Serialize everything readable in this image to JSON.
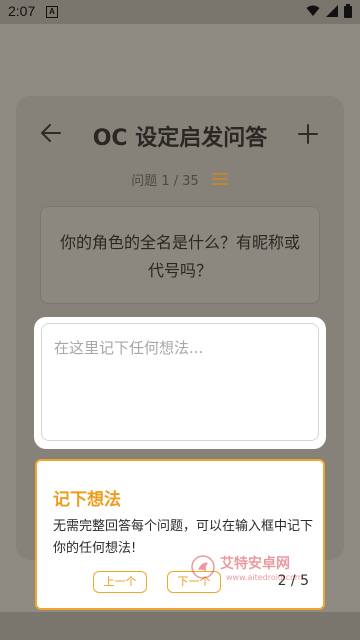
{
  "status_bar": {
    "time": "2:07",
    "notification_letter": "A"
  },
  "header": {
    "title": "OC 设定启发问答",
    "counter": "问题 1 / 35"
  },
  "question": {
    "text": "你的角色的全名是什么？有昵称或代号吗？"
  },
  "input": {
    "placeholder": "在这里记下任何想法..."
  },
  "tip": {
    "title": "记下想法",
    "body": "无需完整回答每个问题，可以在输入框中记下你的任何想法!",
    "prev_label": "上一个",
    "next_label": "下一个",
    "page": "2 / 5"
  },
  "watermark": {
    "text": "艾特安卓网",
    "url": "www.aitedroid.com"
  },
  "colors": {
    "accent": "#f0a72e",
    "overlay": "#8f8b82"
  }
}
